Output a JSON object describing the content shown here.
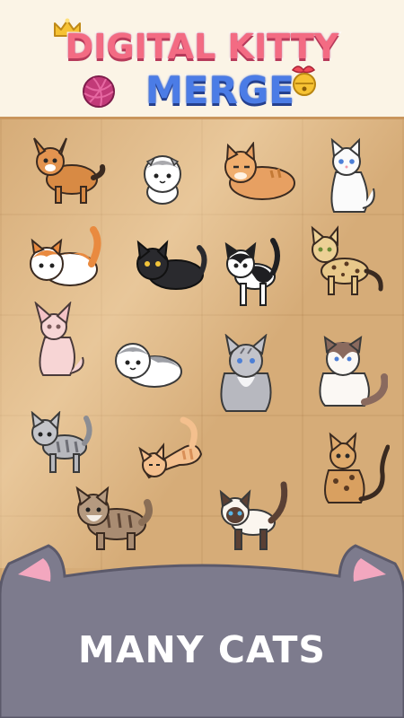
{
  "title": {
    "line1": "DIGITAL KITTY",
    "line2": "MERGE"
  },
  "caption": "MANY CATS",
  "colors": {
    "title_pink": "#f36b83",
    "title_blue": "#4b7ce6",
    "floor": "#d6ac78",
    "header_bg": "#fbf4e6",
    "footer_gray": "#7d7b8d"
  },
  "cats": [
    "caracal-cat",
    "scottish-fold-gray-cat",
    "orange-lying-cat",
    "white-sitting-cat",
    "orange-white-lying-cat",
    "black-lying-cat",
    "black-white-cat",
    "bengal-cat",
    "sphynx-cat",
    "gray-fold-lying-cat",
    "maine-coon-cat",
    "ragdoll-cat",
    "tabby-gray-cat",
    "orange-stretching-cat",
    "spotted-bengal-sitting-cat",
    "fluffy-tabby-cat",
    "siamese-cat"
  ]
}
